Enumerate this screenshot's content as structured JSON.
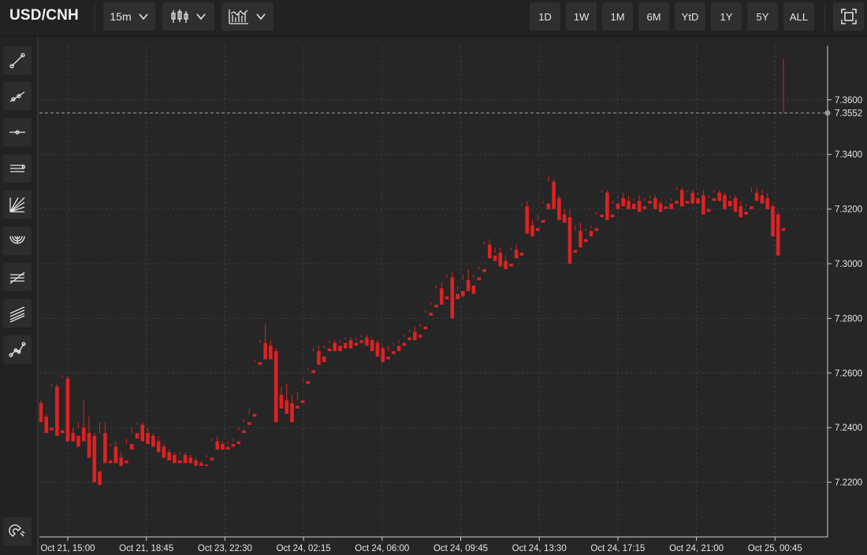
{
  "toolbar": {
    "symbol": "USD/CNH",
    "interval": "15m",
    "chart_style_icon": "candlestick-icon",
    "indicators_icon": "indicators-icon",
    "ranges": [
      "1D",
      "1W",
      "1M",
      "6M",
      "YtD",
      "1Y",
      "5Y",
      "ALL"
    ],
    "fullscreen_icon": "fullscreen-icon"
  },
  "sidebar": {
    "tools": [
      "trend-line-icon",
      "ray-icon",
      "horizontal-line-icon",
      "parallel-channel-icon",
      "fib-fan-icon",
      "fib-arc-icon",
      "fib-retracement-icon",
      "fib-channel-icon",
      "path-icon"
    ],
    "bottom_tool": "magnet-icon"
  },
  "colors": {
    "up": "#22dd22",
    "down": "#dd2222",
    "background": "#262626",
    "grid": "#3a3a3a"
  },
  "chart_data": {
    "type": "candlestick",
    "title": "USD/CNH",
    "interval": "15m",
    "grid": true,
    "ylim": [
      7.2,
      7.38
    ],
    "yticks": [
      "7.2200",
      "7.2400",
      "7.2600",
      "7.2800",
      "7.3000",
      "7.3200",
      "7.3400",
      "7.3600"
    ],
    "xticks": [
      "Oct 21, 15:00",
      "Oct 21, 18:45",
      "Oct 23, 22:30",
      "Oct 24, 02:15",
      "Oct 24, 06:00",
      "Oct 24, 09:45",
      "Oct 24, 13:30",
      "Oct 24, 17:15",
      "Oct 24, 21:00",
      "Oct 25, 00:45"
    ],
    "last_price": "7.3552",
    "candles": [
      [
        7.249,
        7.25,
        7.244,
        7.242
      ],
      [
        7.244,
        7.245,
        7.239,
        7.238
      ],
      [
        7.24,
        7.256,
        7.255,
        7.239
      ],
      [
        7.255,
        7.256,
        7.239,
        7.237
      ],
      [
        7.239,
        7.259,
        7.258,
        7.238
      ],
      [
        7.258,
        7.259,
        7.238,
        7.235
      ],
      [
        7.238,
        7.24,
        7.237,
        7.235
      ],
      [
        7.237,
        7.242,
        7.24,
        7.233
      ],
      [
        7.24,
        7.25,
        7.238,
        7.235
      ],
      [
        7.238,
        7.244,
        7.237,
        7.229
      ],
      [
        7.237,
        7.238,
        7.224,
        7.22
      ],
      [
        7.224,
        7.242,
        7.238,
        7.219
      ],
      [
        7.238,
        7.242,
        7.228,
        7.227
      ],
      [
        7.228,
        7.234,
        7.233,
        7.227
      ],
      [
        7.233,
        7.235,
        7.229,
        7.227
      ],
      [
        7.229,
        7.231,
        7.228,
        7.226
      ],
      [
        7.228,
        7.236,
        7.234,
        7.227
      ],
      [
        7.234,
        7.24,
        7.238,
        7.232
      ],
      [
        7.238,
        7.242,
        7.241,
        7.236
      ],
      [
        7.241,
        7.242,
        7.238,
        7.235
      ],
      [
        7.238,
        7.24,
        7.237,
        7.234
      ],
      [
        7.237,
        7.238,
        7.235,
        7.233
      ],
      [
        7.235,
        7.237,
        7.233,
        7.231
      ],
      [
        7.233,
        7.234,
        7.231,
        7.229
      ],
      [
        7.231,
        7.232,
        7.23,
        7.228
      ],
      [
        7.23,
        7.231,
        7.228,
        7.227
      ],
      [
        7.228,
        7.231,
        7.23,
        7.227
      ],
      [
        7.23,
        7.231,
        7.229,
        7.227
      ],
      [
        7.229,
        7.23,
        7.228,
        7.227
      ],
      [
        7.228,
        7.229,
        7.227,
        7.226
      ],
      [
        7.227,
        7.228,
        7.2265,
        7.226
      ],
      [
        7.2265,
        7.23,
        7.229,
        7.226
      ],
      [
        7.229,
        7.236,
        7.235,
        7.228
      ],
      [
        7.235,
        7.237,
        7.234,
        7.232
      ],
      [
        7.234,
        7.235,
        7.233,
        7.232
      ],
      [
        7.233,
        7.235,
        7.234,
        7.232
      ],
      [
        7.234,
        7.236,
        7.235,
        7.233
      ],
      [
        7.235,
        7.24,
        7.239,
        7.234
      ],
      [
        7.239,
        7.243,
        7.242,
        7.238
      ],
      [
        7.242,
        7.247,
        7.245,
        7.241
      ],
      [
        7.245,
        7.265,
        7.264,
        7.244
      ],
      [
        7.264,
        7.272,
        7.271,
        7.263
      ],
      [
        7.271,
        7.278,
        7.27,
        7.265
      ],
      [
        7.27,
        7.272,
        7.268,
        7.265
      ],
      [
        7.268,
        7.269,
        7.252,
        7.242
      ],
      [
        7.252,
        7.255,
        7.25,
        7.247
      ],
      [
        7.25,
        7.256,
        7.249,
        7.245
      ],
      [
        7.249,
        7.252,
        7.248,
        7.242
      ],
      [
        7.248,
        7.253,
        7.25,
        7.247
      ],
      [
        7.25,
        7.258,
        7.257,
        7.249
      ],
      [
        7.257,
        7.262,
        7.261,
        7.256
      ],
      [
        7.261,
        7.269,
        7.268,
        7.26
      ],
      [
        7.268,
        7.27,
        7.266,
        7.263
      ],
      [
        7.266,
        7.27,
        7.269,
        7.264
      ],
      [
        7.269,
        7.272,
        7.271,
        7.268
      ],
      [
        7.271,
        7.272,
        7.27,
        7.268
      ],
      [
        7.27,
        7.272,
        7.271,
        7.268
      ],
      [
        7.271,
        7.273,
        7.272,
        7.269
      ],
      [
        7.272,
        7.273,
        7.271,
        7.269
      ],
      [
        7.271,
        7.273,
        7.272,
        7.27
      ],
      [
        7.272,
        7.274,
        7.273,
        7.271
      ],
      [
        7.273,
        7.274,
        7.272,
        7.27
      ],
      [
        7.272,
        7.273,
        7.271,
        7.268
      ],
      [
        7.271,
        7.272,
        7.269,
        7.266
      ],
      [
        7.269,
        7.27,
        7.266,
        7.264
      ],
      [
        7.266,
        7.27,
        7.268,
        7.265
      ],
      [
        7.268,
        7.271,
        7.27,
        7.267
      ],
      [
        7.27,
        7.272,
        7.271,
        7.268
      ],
      [
        7.271,
        7.274,
        7.273,
        7.27
      ],
      [
        7.273,
        7.276,
        7.275,
        7.272
      ],
      [
        7.275,
        7.277,
        7.274,
        7.272
      ],
      [
        7.274,
        7.278,
        7.277,
        7.273
      ],
      [
        7.277,
        7.283,
        7.282,
        7.276
      ],
      [
        7.282,
        7.286,
        7.285,
        7.281
      ],
      [
        7.285,
        7.292,
        7.291,
        7.284
      ],
      [
        7.291,
        7.293,
        7.288,
        7.285
      ],
      [
        7.288,
        7.296,
        7.295,
        7.287
      ],
      [
        7.295,
        7.297,
        7.289,
        7.28
      ],
      [
        7.289,
        7.292,
        7.29,
        7.287
      ],
      [
        7.29,
        7.296,
        7.294,
        7.288
      ],
      [
        7.294,
        7.298,
        7.292,
        7.29
      ],
      [
        7.292,
        7.296,
        7.295,
        7.289
      ],
      [
        7.295,
        7.299,
        7.298,
        7.294
      ],
      [
        7.298,
        7.308,
        7.307,
        7.297
      ],
      [
        7.307,
        7.309,
        7.303,
        7.302
      ],
      [
        7.303,
        7.306,
        7.304,
        7.301
      ],
      [
        7.304,
        7.306,
        7.301,
        7.299
      ],
      [
        7.301,
        7.303,
        7.3,
        7.298
      ],
      [
        7.3,
        7.306,
        7.305,
        7.299
      ],
      [
        7.305,
        7.307,
        7.304,
        7.302
      ],
      [
        7.304,
        7.322,
        7.321,
        7.303
      ],
      [
        7.321,
        7.323,
        7.314,
        7.311
      ],
      [
        7.314,
        7.316,
        7.313,
        7.31
      ],
      [
        7.313,
        7.318,
        7.316,
        7.312
      ],
      [
        7.316,
        7.323,
        7.322,
        7.315
      ],
      [
        7.322,
        7.332,
        7.33,
        7.32
      ],
      [
        7.33,
        7.331,
        7.324,
        7.32
      ],
      [
        7.324,
        7.325,
        7.318,
        7.316
      ],
      [
        7.318,
        7.32,
        7.317,
        7.315
      ],
      [
        7.317,
        7.32,
        7.305,
        7.3
      ],
      [
        7.305,
        7.314,
        7.312,
        7.304
      ],
      [
        7.312,
        7.315,
        7.309,
        7.306
      ],
      [
        7.309,
        7.313,
        7.312,
        7.308
      ],
      [
        7.312,
        7.314,
        7.313,
        7.31
      ],
      [
        7.313,
        7.319,
        7.318,
        7.312
      ],
      [
        7.318,
        7.327,
        7.326,
        7.317
      ],
      [
        7.326,
        7.327,
        7.318,
        7.316
      ],
      [
        7.318,
        7.323,
        7.322,
        7.317
      ],
      [
        7.322,
        7.325,
        7.324,
        7.32
      ],
      [
        7.324,
        7.326,
        7.323,
        7.321
      ],
      [
        7.323,
        7.325,
        7.322,
        7.32
      ],
      [
        7.322,
        7.324,
        7.323,
        7.32
      ],
      [
        7.323,
        7.325,
        7.321,
        7.319
      ],
      [
        7.321,
        7.324,
        7.323,
        7.32
      ],
      [
        7.323,
        7.325,
        7.324,
        7.322
      ],
      [
        7.324,
        7.325,
        7.322,
        7.32
      ],
      [
        7.322,
        7.323,
        7.321,
        7.319
      ],
      [
        7.321,
        7.323,
        7.322,
        7.32
      ],
      [
        7.322,
        7.324,
        7.323,
        7.32
      ],
      [
        7.323,
        7.328,
        7.327,
        7.322
      ],
      [
        7.327,
        7.328,
        7.323,
        7.321
      ],
      [
        7.323,
        7.327,
        7.326,
        7.322
      ],
      [
        7.326,
        7.327,
        7.324,
        7.322
      ],
      [
        7.324,
        7.326,
        7.325,
        7.322
      ],
      [
        7.325,
        7.327,
        7.32,
        7.318
      ],
      [
        7.32,
        7.325,
        7.324,
        7.319
      ],
      [
        7.324,
        7.327,
        7.326,
        7.323
      ],
      [
        7.326,
        7.327,
        7.325,
        7.323
      ],
      [
        7.325,
        7.326,
        7.323,
        7.32
      ],
      [
        7.323,
        7.325,
        7.324,
        7.321
      ],
      [
        7.324,
        7.325,
        7.321,
        7.319
      ],
      [
        7.321,
        7.323,
        7.319,
        7.317
      ],
      [
        7.319,
        7.322,
        7.321,
        7.318
      ],
      [
        7.321,
        7.328,
        7.326,
        7.32
      ],
      [
        7.326,
        7.328,
        7.325,
        7.323
      ],
      [
        7.325,
        7.327,
        7.324,
        7.322
      ],
      [
        7.324,
        7.326,
        7.321,
        7.32
      ],
      [
        7.321,
        7.322,
        7.318,
        7.31
      ],
      [
        7.318,
        7.319,
        7.313,
        7.303
      ],
      [
        7.313,
        7.375,
        7.3552,
        7.312
      ]
    ]
  }
}
